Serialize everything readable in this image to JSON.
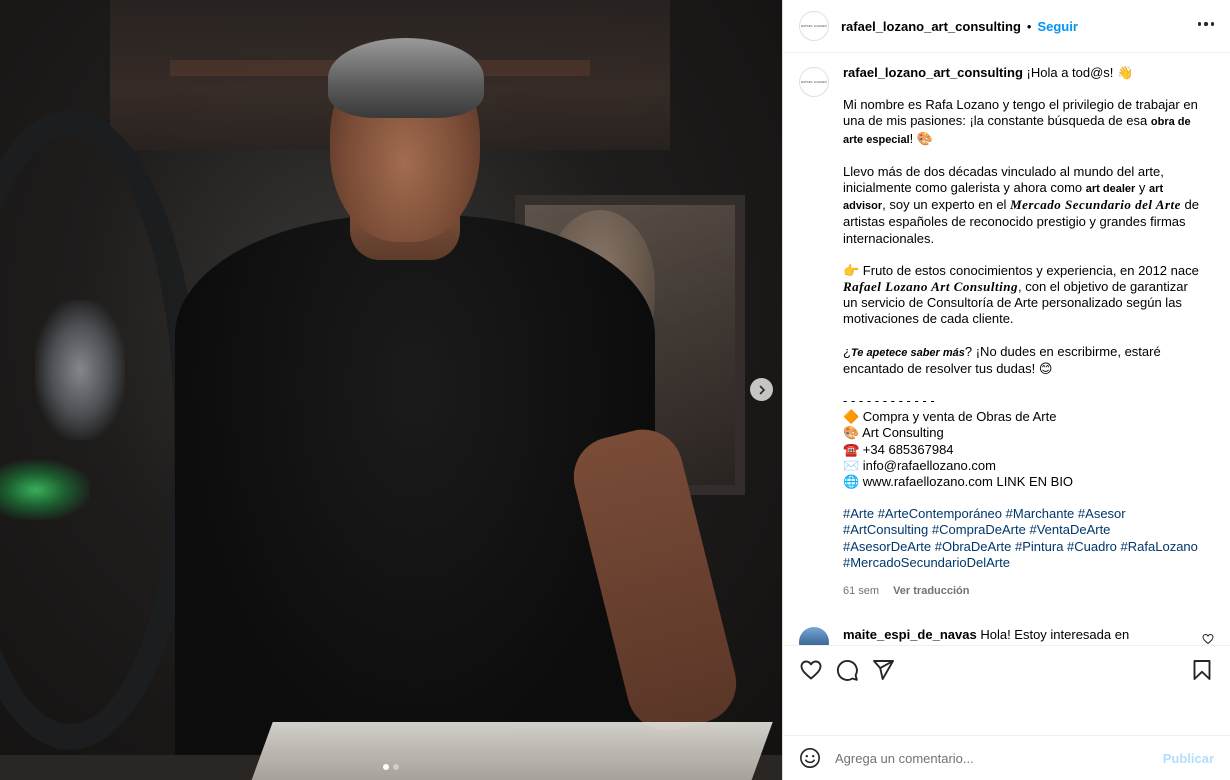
{
  "post": {
    "image_icons": {
      "next": "chevron-right-icon"
    },
    "carousel": {
      "count": 2,
      "active": 1
    }
  },
  "header": {
    "username": "rafael_lozano_art_consulting",
    "separator": "•",
    "follow_label": "Seguir",
    "avatar_text": "RAFAEL LOZANO"
  },
  "caption": {
    "username": "rafael_lozano_art_consulting",
    "greeting": "¡Hola a tod@s! 👋",
    "p1_a": "Mi nombre es Rafa Lozano y tengo el privilegio de trabajar en una de mis pasiones: ¡la constante búsqueda de esa ",
    "p1_b": "obra de arte especial",
    "p1_c": "! 🎨",
    "p2_a": "Llevo más de dos décadas vinculado al mundo del arte, inicialmente como galerista y ahora como ",
    "p2_b": "art dealer",
    "p2_c": " y ",
    "p2_d": "art advisor",
    "p2_e": ", soy un experto en el ",
    "p2_f": "Mercado Secundario del Arte",
    "p2_g": " de artistas españoles de reconocido prestigio y grandes firmas internacionales.",
    "p3_a": "👉 Fruto de estos conocimientos y experiencia, en 2012 nace ",
    "p3_b": "Rafael Lozano Art Consulting",
    "p3_c": ", con el objetivo de garantizar un servicio de Consultoría de Arte personalizado según las motivaciones de cada cliente.",
    "p4_a": "¿",
    "p4_b": "Te apetece saber más",
    "p4_c": "? ¡No dudes en escribirme, estaré encantado de resolver tus dudas! 😊",
    "divider": "- - - - - - - - - - - -",
    "line1": "🔶 Compra y venta de Obras de Arte",
    "line2": "🎨 Art Consulting",
    "line3": "☎️ +34 685367984",
    "line4": "✉️ info@rafaellozano.com",
    "line5": "🌐 www.rafaellozano.com LINK EN BIO",
    "hashtags": [
      "#Arte",
      "#ArteContemporáneo",
      "#Marchante",
      "#Asesor",
      "#ArtConsulting",
      "#CompraDeArte",
      "#VentaDeArte",
      "#AsesorDeArte",
      "#ObraDeArte",
      "#Pintura",
      "#Cuadro",
      "#RafaLozano",
      "#MercadoSecundarioDelArte"
    ],
    "time": "61 sem",
    "translate": "Ver traducción"
  },
  "comments": [
    {
      "username": "maite_espi_de_navas",
      "text": "Hola! Estoy interesada en contactar contigo."
    }
  ],
  "actions": {
    "like": "heart-icon",
    "comment": "comment-icon",
    "share": "send-icon",
    "save": "bookmark-icon"
  },
  "add_comment": {
    "placeholder": "Agrega un comentario...",
    "publish_label": "Publicar"
  },
  "colors": {
    "link": "#0095f6",
    "hashtag": "#00376b",
    "muted": "#737373",
    "publish_disabled": "#b2dffc"
  }
}
